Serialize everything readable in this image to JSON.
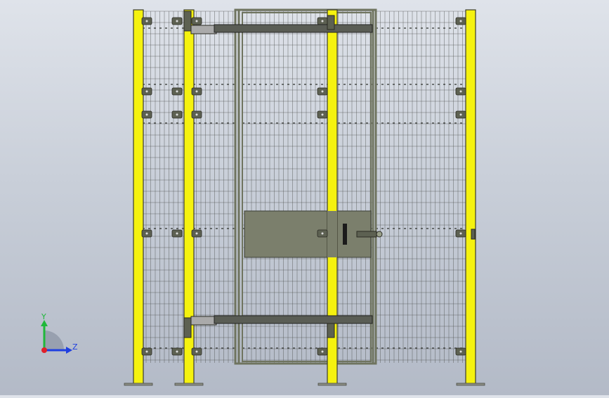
{
  "viewport": {
    "background_top": "#dfe3ea",
    "background_bottom": "#b3bac7"
  },
  "colors": {
    "post_yellow": "#f5f20f",
    "post_outline": "#3b3b2e",
    "mesh_line": "#4a4d4a",
    "frame": "#6f745f",
    "door_panel": "#7b7f6c",
    "bracket": "#5d6152",
    "axis_x": "#e0202a",
    "axis_y": "#1fb83a",
    "axis_z": "#1f3fe0"
  },
  "triad": {
    "y_label": "Y",
    "z_label": "Z",
    "icon": "coordinate-triad-icon"
  }
}
